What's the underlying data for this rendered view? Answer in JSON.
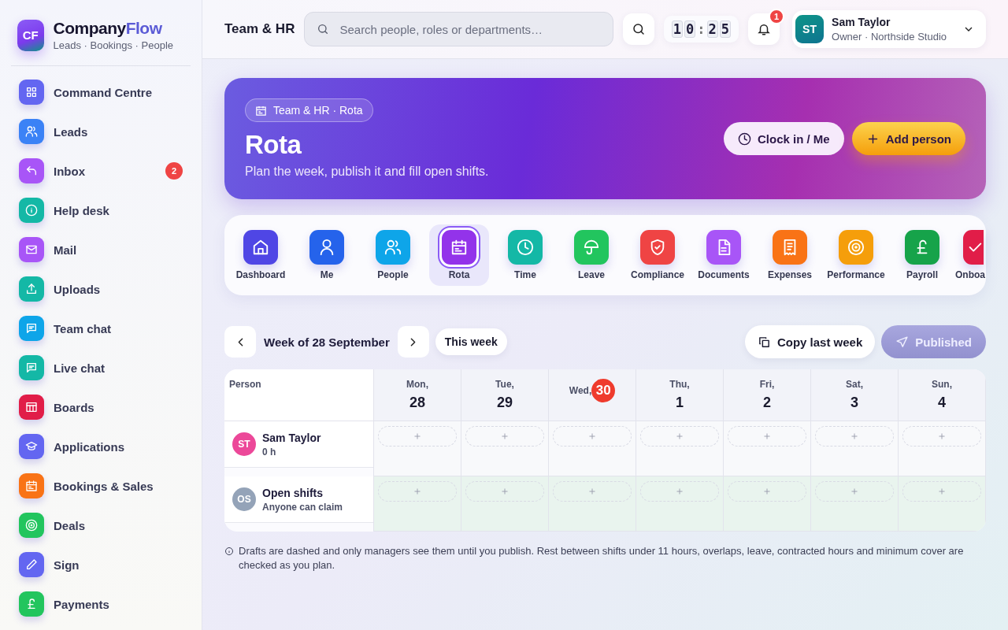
{
  "brand": {
    "initials": "CF",
    "name_main": "Company",
    "name_accent": "Flow",
    "tagline": "Leads · Bookings · People"
  },
  "sidebar": {
    "items": [
      {
        "label": "Command Centre",
        "color": "#6366f1",
        "selected": false
      },
      {
        "label": "Leads",
        "color": "#3b82f6",
        "selected": false
      },
      {
        "label": "Inbox",
        "color": "#a855f7",
        "selected": false,
        "badge": "2"
      },
      {
        "label": "Help desk",
        "color": "#14b8a6",
        "selected": false
      },
      {
        "label": "Mail",
        "color": "#a855f7",
        "selected": false
      },
      {
        "label": "Uploads",
        "color": "#14b8a6",
        "selected": false
      },
      {
        "label": "Team chat",
        "color": "#0ea5e9",
        "selected": false
      },
      {
        "label": "Live chat",
        "color": "#14b8a6",
        "selected": false
      },
      {
        "label": "Boards",
        "color": "#e11d48",
        "selected": false
      },
      {
        "label": "Applications",
        "color": "#6366f1",
        "selected": false
      },
      {
        "label": "Bookings & Sales",
        "color": "#f97316",
        "selected": false
      },
      {
        "label": "Deals",
        "color": "#22c55e",
        "selected": false
      },
      {
        "label": "Sign",
        "color": "#6366f1",
        "selected": false
      },
      {
        "label": "Payments",
        "color": "#22c55e",
        "selected": false
      }
    ]
  },
  "topbar": {
    "title": "Team & HR",
    "search": {
      "placeholder": "Search people, roles or departments…"
    },
    "clock": {
      "digits": [
        "1",
        "0",
        "2",
        "5"
      ],
      "separator": ":"
    },
    "notifications": "1",
    "user": {
      "initials": "ST",
      "name": "Sam Taylor",
      "role": "Owner · Northside Studio"
    }
  },
  "hero": {
    "breadcrumb": "Team & HR · Rota",
    "title": "Rota",
    "subtitle": "Plan the week, publish it and fill open shifts.",
    "buttons": [
      "Clock in / Me",
      "Add person"
    ]
  },
  "apps": [
    {
      "label": "Dashboard",
      "color": "#4f46e5",
      "selected": false
    },
    {
      "label": "Me",
      "color": "#2563eb",
      "selected": false
    },
    {
      "label": "People",
      "color": "#0ea5e9",
      "selected": false
    },
    {
      "label": "Rota",
      "color": "#9333ea",
      "selected": true
    },
    {
      "label": "Time",
      "color": "#14b8a6",
      "selected": false
    },
    {
      "label": "Leave",
      "color": "#22c55e",
      "selected": false
    },
    {
      "label": "Compliance",
      "color": "#ef4444",
      "selected": false
    },
    {
      "label": "Documents",
      "color": "#a855f7",
      "selected": false
    },
    {
      "label": "Expenses",
      "color": "#f97316",
      "selected": false
    },
    {
      "label": "Performance",
      "color": "#f59e0b",
      "selected": false
    },
    {
      "label": "Payroll",
      "color": "#16a34a",
      "selected": false
    },
    {
      "label": "Onboa",
      "color": "#e11d48",
      "selected": false
    }
  ],
  "week": {
    "label": "Week of 28 September",
    "this_week": "This week",
    "copy": "Copy last week",
    "publish": "Published",
    "published": true
  },
  "table": {
    "person_header": "Person",
    "days": [
      {
        "day": "Mon,",
        "date": "28",
        "today": false
      },
      {
        "day": "Tue,",
        "date": "29",
        "today": false
      },
      {
        "day": "Wed,",
        "date": "30",
        "today": true
      },
      {
        "day": "Thu,",
        "date": "1",
        "today": false
      },
      {
        "day": "Fri,",
        "date": "2",
        "today": false
      },
      {
        "day": "Sat,",
        "date": "3",
        "today": false
      },
      {
        "day": "Sun,",
        "date": "4",
        "today": false
      }
    ],
    "rows": [
      {
        "kind": "person",
        "initials": "ST",
        "name": "Sam Taylor",
        "detail": "0 h",
        "color": "#ec4899"
      },
      {
        "kind": "open",
        "initials": "OS",
        "name": "Open shifts",
        "detail": "Anyone can claim",
        "color": "#94a3b8"
      }
    ]
  },
  "note": "Drafts are dashed and only managers see them until you publish. Rest between shifts under 11 hours, overlaps, leave, contracted hours and minimum cover are checked as you plan."
}
